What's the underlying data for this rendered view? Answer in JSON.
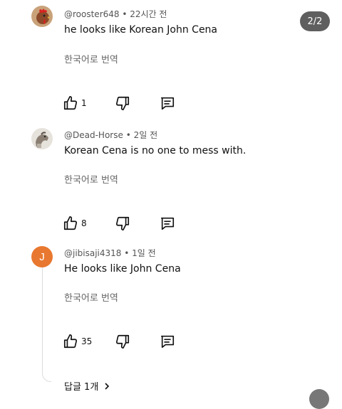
{
  "page_indicator": "2/2",
  "comments": [
    {
      "handle": "@rooster648",
      "time": "• 22시간 전",
      "text": "he looks like Korean John Cena",
      "translate": "한국어로 번역",
      "likes": "1"
    },
    {
      "handle": "@Dead-Horse",
      "time": "• 2일 전",
      "text": "Korean Cena is no one to mess with.",
      "translate": "한국어로 번역",
      "likes": "8"
    },
    {
      "handle": "@jibisaji4318",
      "time": "• 1일 전",
      "text": "He looks like John Cena",
      "translate": "한국어로 번역",
      "likes": "35",
      "avatar_letter": "J",
      "avatar_color": "#e8782f"
    }
  ],
  "replies_label": "답글 1개",
  "icons": {
    "like": "thumbs-up-icon",
    "dislike": "thumbs-down-icon",
    "reply": "comment-icon",
    "chevron": "chevron-right-icon"
  }
}
